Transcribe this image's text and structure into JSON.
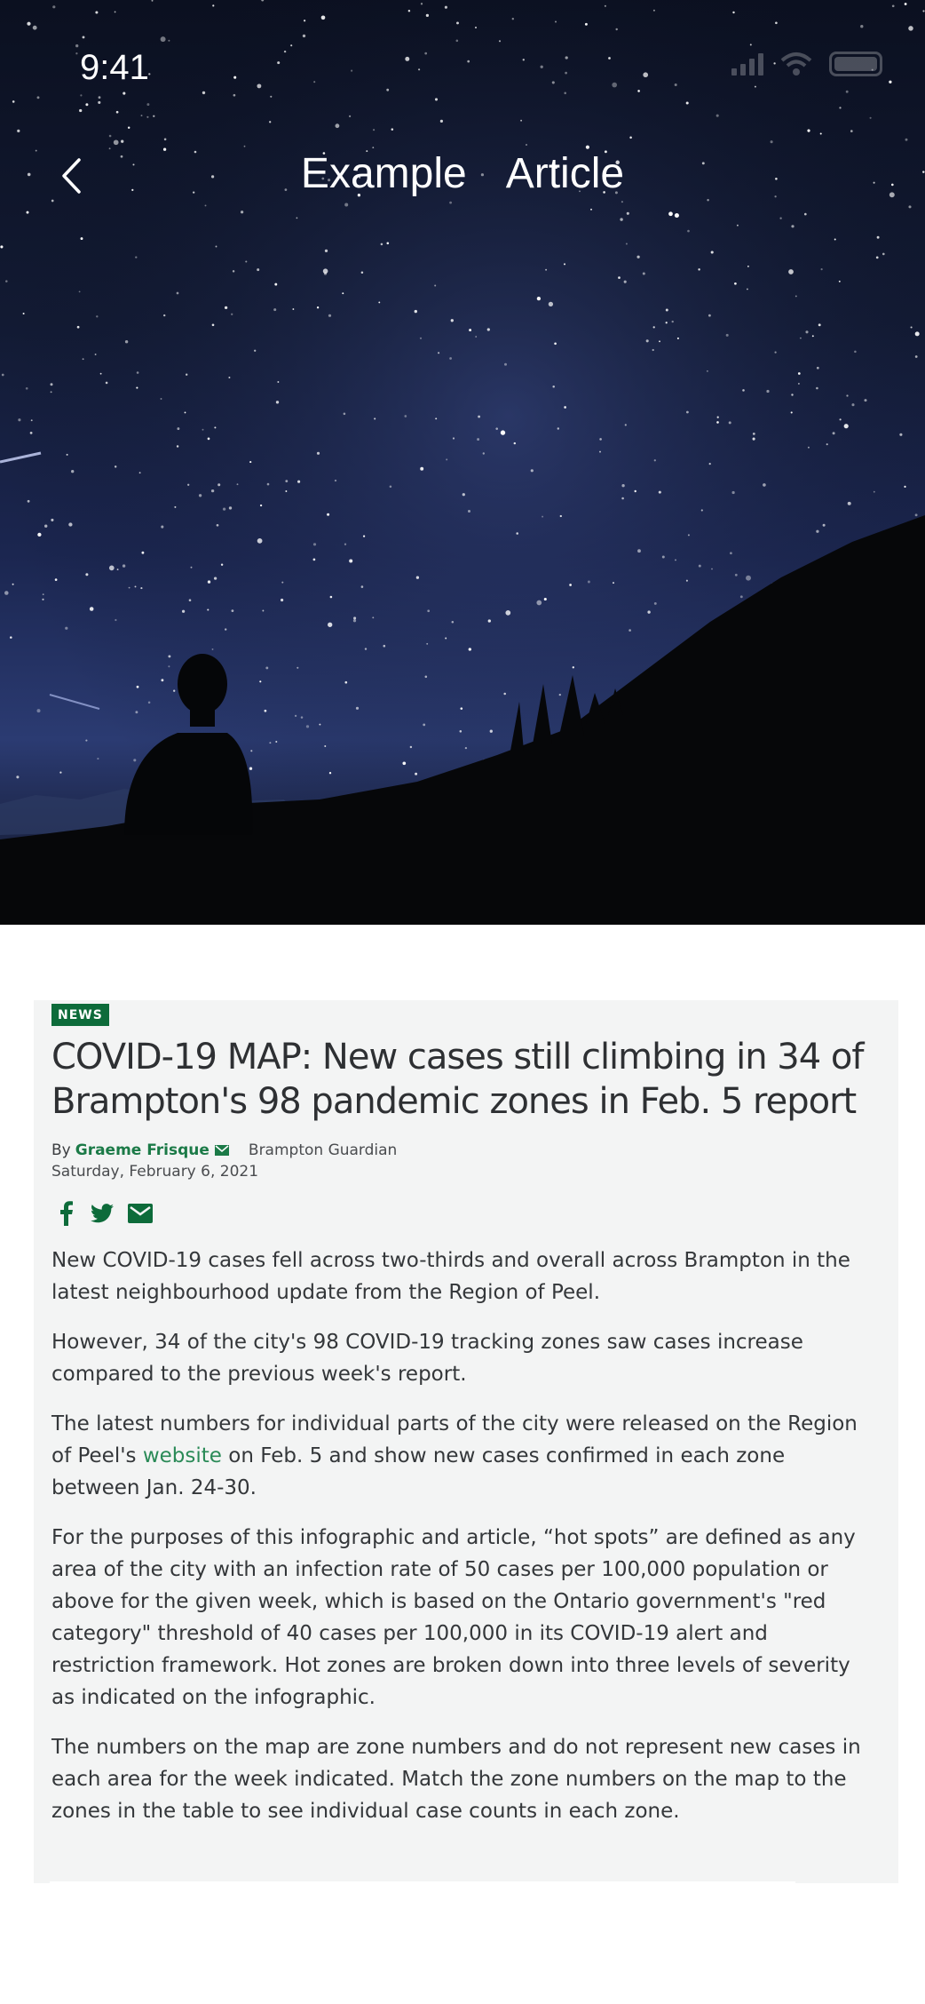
{
  "status_bar": {
    "time": "9:41"
  },
  "nav": {
    "title": "Example  Article",
    "back_icon": "chevron-left-icon"
  },
  "hero": {
    "image": "starry-night-sky-silhouette"
  },
  "article": {
    "category": "NEWS",
    "headline": "COVID-19 MAP: New cases still climbing in 34 of Brampton's 98 pandemic zones in Feb. 5 report",
    "byline_prefix": "By",
    "author": "Graeme Frisque",
    "publisher": "Brampton Guardian",
    "date": "Saturday, February 6, 2021",
    "share_icons": [
      "facebook-icon",
      "twitter-icon",
      "email-icon"
    ],
    "paragraphs": {
      "p1": "New COVID-19 cases fell across two-thirds and overall across Brampton in the latest neighbourhood update from the Region of Peel.",
      "p2": "However, 34 of the city's 98 COVID-19 tracking zones saw cases increase compared to the previous week's report.",
      "p3_before": "The latest numbers for individual parts of the city were released on the Region of Peel's ",
      "p3_link": "website",
      "p3_after": " on Feb. 5 and show new cases confirmed in each zone between Jan. 24-30.",
      "p4": "For the purposes of this infographic and article, “hot spots” are defined as any area of the city with an infection rate of 50 cases per 100,000 population or above for the given week, which is based on the Ontario government's \"red category\" threshold of 40 cases per 100,000 in its COVID-19 alert and restriction framework. Hot zones are broken down into three levels of severity as indicated on the infographic.",
      "p5": "The numbers on the map are zone numbers and do not represent new cases in each area for the week indicated. Match the zone numbers on the map to the zones in the table to see individual case counts in each zone."
    }
  },
  "colors": {
    "accent_green": "#0d6b3a",
    "link_green": "#2a8a57",
    "card_bg": "#f3f4f4"
  }
}
